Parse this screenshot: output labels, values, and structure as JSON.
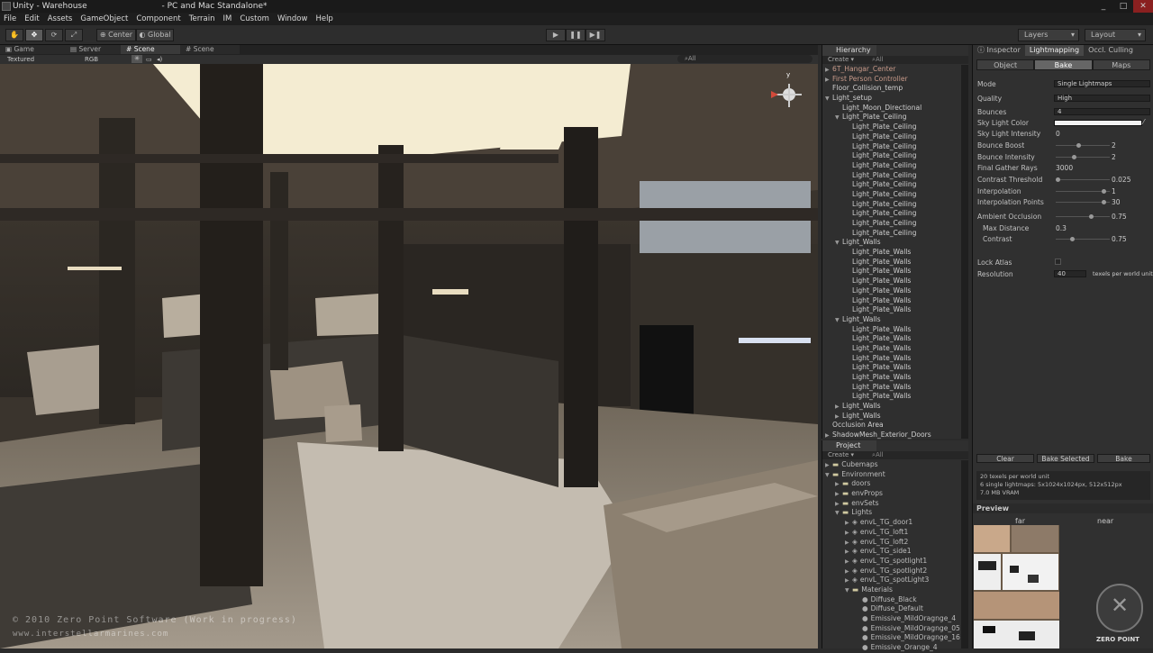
{
  "title_bar": {
    "title": "Unity - Warehouse",
    "title_suffix": "- PC and Mac Standalone*",
    "minimize": "_",
    "maximize": "□",
    "close": "✕"
  },
  "menu": [
    "File",
    "Edit",
    "Assets",
    "GameObject",
    "Component",
    "Terrain",
    "IM",
    "Custom",
    "Window",
    "Help"
  ],
  "toolbar": {
    "center_label": "Center",
    "global_label": "Global",
    "layers_label": "Layers",
    "layout_label": "Layout"
  },
  "scene": {
    "tabs": [
      "Game",
      "Server",
      "Scene",
      "Scene"
    ],
    "render_mode": "Textured",
    "color_mode": "RGB",
    "search_placeholder": "All"
  },
  "overlay": {
    "copyright": "© 2010 Zero Point Software (Work in progress)",
    "url": "www.interstellarmarines.com"
  },
  "hierarchy": {
    "title": "Hierarchy",
    "create": "Create",
    "search_placeholder": "All",
    "items": [
      {
        "label": "6T_Hangar_Center",
        "arrow": "▶",
        "indent": 0,
        "color": "#c89a8a"
      },
      {
        "label": "First Person Controller",
        "arrow": "▶",
        "indent": 0,
        "color": "#c89a8a"
      },
      {
        "label": "Floor_Collision_temp",
        "arrow": "",
        "indent": 0,
        "color": "#d0d0d0"
      },
      {
        "label": "Light_setup",
        "arrow": "▼",
        "indent": 0,
        "color": "#d0d0d0"
      },
      {
        "label": "Light_Moon_Directional",
        "arrow": "",
        "indent": 1,
        "color": "#d0d0d0"
      },
      {
        "label": "Light_Plate_Ceiling",
        "arrow": "▼",
        "indent": 1,
        "color": "#d0d0d0"
      },
      {
        "label": "Light_Plate_Ceiling",
        "arrow": "",
        "indent": 2,
        "color": "#d0d0d0"
      },
      {
        "label": "Light_Plate_Ceiling",
        "arrow": "",
        "indent": 2,
        "color": "#d0d0d0"
      },
      {
        "label": "Light_Plate_Ceiling",
        "arrow": "",
        "indent": 2,
        "color": "#d0d0d0"
      },
      {
        "label": "Light_Plate_Ceiling",
        "arrow": "",
        "indent": 2,
        "color": "#d0d0d0"
      },
      {
        "label": "Light_Plate_Ceiling",
        "arrow": "",
        "indent": 2,
        "color": "#d0d0d0"
      },
      {
        "label": "Light_Plate_Ceiling",
        "arrow": "",
        "indent": 2,
        "color": "#d0d0d0"
      },
      {
        "label": "Light_Plate_Ceiling",
        "arrow": "",
        "indent": 2,
        "color": "#d0d0d0"
      },
      {
        "label": "Light_Plate_Ceiling",
        "arrow": "",
        "indent": 2,
        "color": "#d0d0d0"
      },
      {
        "label": "Light_Plate_Ceiling",
        "arrow": "",
        "indent": 2,
        "color": "#d0d0d0"
      },
      {
        "label": "Light_Plate_Ceiling",
        "arrow": "",
        "indent": 2,
        "color": "#d0d0d0"
      },
      {
        "label": "Light_Plate_Ceiling",
        "arrow": "",
        "indent": 2,
        "color": "#d0d0d0"
      },
      {
        "label": "Light_Plate_Ceiling",
        "arrow": "",
        "indent": 2,
        "color": "#d0d0d0"
      },
      {
        "label": "Light_Walls",
        "arrow": "▼",
        "indent": 1,
        "color": "#d0d0d0"
      },
      {
        "label": "Light_Plate_Walls",
        "arrow": "",
        "indent": 2,
        "color": "#d0d0d0"
      },
      {
        "label": "Light_Plate_Walls",
        "arrow": "",
        "indent": 2,
        "color": "#d0d0d0"
      },
      {
        "label": "Light_Plate_Walls",
        "arrow": "",
        "indent": 2,
        "color": "#d0d0d0"
      },
      {
        "label": "Light_Plate_Walls",
        "arrow": "",
        "indent": 2,
        "color": "#d0d0d0"
      },
      {
        "label": "Light_Plate_Walls",
        "arrow": "",
        "indent": 2,
        "color": "#d0d0d0"
      },
      {
        "label": "Light_Plate_Walls",
        "arrow": "",
        "indent": 2,
        "color": "#d0d0d0"
      },
      {
        "label": "Light_Plate_Walls",
        "arrow": "",
        "indent": 2,
        "color": "#d0d0d0"
      },
      {
        "label": "Light_Walls",
        "arrow": "▼",
        "indent": 1,
        "color": "#d0d0d0"
      },
      {
        "label": "Light_Plate_Walls",
        "arrow": "",
        "indent": 2,
        "color": "#d0d0d0"
      },
      {
        "label": "Light_Plate_Walls",
        "arrow": "",
        "indent": 2,
        "color": "#d0d0d0"
      },
      {
        "label": "Light_Plate_Walls",
        "arrow": "",
        "indent": 2,
        "color": "#d0d0d0"
      },
      {
        "label": "Light_Plate_Walls",
        "arrow": "",
        "indent": 2,
        "color": "#d0d0d0"
      },
      {
        "label": "Light_Plate_Walls",
        "arrow": "",
        "indent": 2,
        "color": "#d0d0d0"
      },
      {
        "label": "Light_Plate_Walls",
        "arrow": "",
        "indent": 2,
        "color": "#d0d0d0"
      },
      {
        "label": "Light_Plate_Walls",
        "arrow": "",
        "indent": 2,
        "color": "#d0d0d0"
      },
      {
        "label": "Light_Plate_Walls",
        "arrow": "",
        "indent": 2,
        "color": "#d0d0d0"
      },
      {
        "label": "Light_Walls",
        "arrow": "▶",
        "indent": 1,
        "color": "#d0d0d0"
      },
      {
        "label": "Light_Walls",
        "arrow": "▶",
        "indent": 1,
        "color": "#d0d0d0"
      },
      {
        "label": "Occlusion Area",
        "arrow": "",
        "indent": 0,
        "color": "#d0d0d0"
      },
      {
        "label": "ShadowMesh_Exterior_Doors",
        "arrow": "▶",
        "indent": 0,
        "color": "#d0d0d0"
      }
    ]
  },
  "project": {
    "title": "Project",
    "create": "Create",
    "search_placeholder": "All",
    "items": [
      {
        "label": "Cubemaps",
        "arrow": "▶",
        "indent": 0,
        "icon": "folder"
      },
      {
        "label": "Environment",
        "arrow": "▼",
        "indent": 0,
        "icon": "folder"
      },
      {
        "label": "doors",
        "arrow": "▶",
        "indent": 1,
        "icon": "folder"
      },
      {
        "label": "envProps",
        "arrow": "▶",
        "indent": 1,
        "icon": "folder"
      },
      {
        "label": "envSets",
        "arrow": "▶",
        "indent": 1,
        "icon": "folder"
      },
      {
        "label": "Lights",
        "arrow": "▼",
        "indent": 1,
        "icon": "folder"
      },
      {
        "label": "envL_TG_door1",
        "arrow": "▶",
        "indent": 2,
        "icon": "prefab"
      },
      {
        "label": "envL_TG_loft1",
        "arrow": "▶",
        "indent": 2,
        "icon": "prefab"
      },
      {
        "label": "envL_TG_loft2",
        "arrow": "▶",
        "indent": 2,
        "icon": "prefab"
      },
      {
        "label": "envL_TG_side1",
        "arrow": "▶",
        "indent": 2,
        "icon": "prefab"
      },
      {
        "label": "envL_TG_spotlight1",
        "arrow": "▶",
        "indent": 2,
        "icon": "prefab"
      },
      {
        "label": "envL_TG_spotlight2",
        "arrow": "▶",
        "indent": 2,
        "icon": "prefab"
      },
      {
        "label": "envL_TG_spotLight3",
        "arrow": "▶",
        "indent": 2,
        "icon": "prefab"
      },
      {
        "label": "Materials",
        "arrow": "▼",
        "indent": 2,
        "icon": "folder"
      },
      {
        "label": "Diffuse_Black",
        "arrow": "",
        "indent": 3,
        "icon": "material"
      },
      {
        "label": "Diffuse_Default",
        "arrow": "",
        "indent": 3,
        "icon": "material"
      },
      {
        "label": "Emissive_MildOragnge_4",
        "arrow": "",
        "indent": 3,
        "icon": "material"
      },
      {
        "label": "Emissive_MildOragnge_05",
        "arrow": "",
        "indent": 3,
        "icon": "material"
      },
      {
        "label": "Emissive_MildOragnge_16",
        "arrow": "",
        "indent": 3,
        "icon": "material"
      },
      {
        "label": "Emissive_Orange_4",
        "arrow": "",
        "indent": 3,
        "icon": "material"
      }
    ]
  },
  "inspector": {
    "tabs": [
      "Inspector",
      "Lightmapping",
      "Occl. Culling"
    ],
    "segments": [
      "Object",
      "Bake",
      "Maps"
    ],
    "mode": {
      "label": "Mode",
      "value": "Single Lightmaps"
    },
    "quality": {
      "label": "Quality",
      "value": "High"
    },
    "bounces": {
      "label": "Bounces",
      "value": "4"
    },
    "sky_color": {
      "label": "Sky Light Color"
    },
    "sky_intensity": {
      "label": "Sky Light Intensity",
      "value": "0"
    },
    "bounce_boost": {
      "label": "Bounce Boost",
      "value": "2"
    },
    "bounce_intensity": {
      "label": "Bounce Intensity",
      "value": "2"
    },
    "gather_rays": {
      "label": "Final Gather Rays",
      "value": "3000"
    },
    "contrast_threshold": {
      "label": "Contrast Threshold",
      "value": "0.025"
    },
    "interpolation": {
      "label": "Interpolation",
      "value": "1"
    },
    "interp_points": {
      "label": "Interpolation Points",
      "value": "30"
    },
    "ao": {
      "label": "Ambient Occlusion",
      "value": "0.75"
    },
    "max_distance": {
      "label": "Max Distance",
      "value": "0.3"
    },
    "contrast": {
      "label": "Contrast",
      "value": "0.75"
    },
    "lock_atlas": {
      "label": "Lock Atlas"
    },
    "resolution": {
      "label": "Resolution",
      "value": "40",
      "unit": "texels per world unit"
    },
    "buttons": {
      "clear": "Clear",
      "bake_selected": "Bake Selected",
      "bake": "Bake"
    },
    "info": [
      "20 texels per world unit",
      "6 single lightmaps: 5x1024x1024px, 512x512px",
      "7.0 MB VRAM"
    ],
    "preview": {
      "title": "Preview",
      "far": "far",
      "near": "near"
    },
    "logo": "ZERO POINT"
  }
}
